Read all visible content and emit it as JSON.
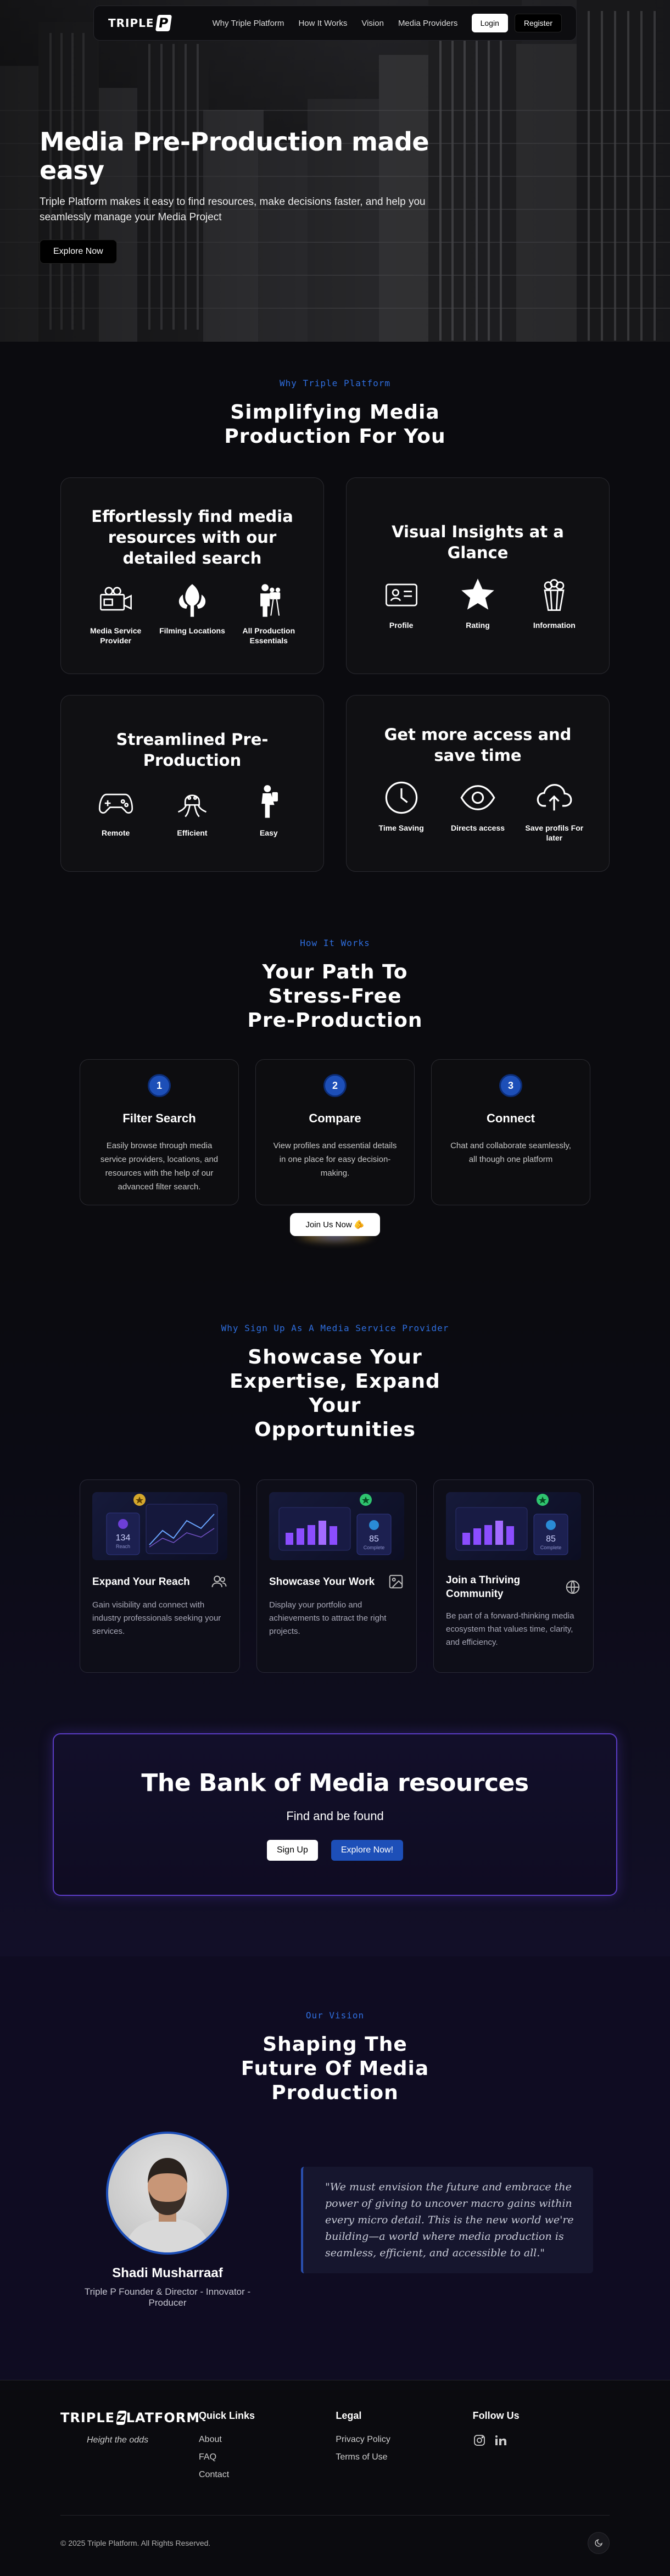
{
  "nav": {
    "logo": "TRIPLE",
    "logo_mark": "P",
    "links": [
      "Why Triple Platform",
      "How It Works",
      "Vision",
      "Media Providers"
    ],
    "login": "Login",
    "register": "Register"
  },
  "hero": {
    "title": "Media Pre-Production made easy",
    "subtitle": "Triple Platform makes it easy to find resources, make decisions faster, and help you seamlessly manage your Media Project",
    "cta": "Explore Now"
  },
  "why": {
    "eyebrow": "Why Triple Platform",
    "title": "Simplifying Media Production For You",
    "cards": [
      {
        "title": "Effortlessly find media resources with our detailed search",
        "items": [
          {
            "icon": "camera-icon",
            "label": "Media Service Provider"
          },
          {
            "icon": "tree-icon",
            "label": "Filming Locations"
          },
          {
            "icon": "crew-icon",
            "label": "All Production Essentials"
          }
        ]
      },
      {
        "title": "Visual Insights at a Glance",
        "items": [
          {
            "icon": "profile-card-icon",
            "label": "Profile"
          },
          {
            "icon": "star-icon",
            "label": "Rating"
          },
          {
            "icon": "popcorn-icon",
            "label": "Information"
          }
        ]
      },
      {
        "title": "Streamlined Pre-Production",
        "items": [
          {
            "icon": "gamepad-icon",
            "label": "Remote"
          },
          {
            "icon": "octopus-icon",
            "label": "Efficient"
          },
          {
            "icon": "sitting-person-icon",
            "label": "Easy"
          }
        ]
      },
      {
        "title": "Get more access and save time",
        "items": [
          {
            "icon": "clock-icon",
            "label": "Time Saving"
          },
          {
            "icon": "eye-icon",
            "label": "Directs access"
          },
          {
            "icon": "cloud-upload-icon",
            "label": "Save profils For later"
          }
        ]
      }
    ]
  },
  "how": {
    "eyebrow": "How It Works",
    "title": "Your Path To Stress-Free Pre-Production",
    "steps": [
      {
        "num": "1",
        "title": "Filter Search",
        "desc": "Easily browse through media service providers, locations, and resources with the help of our advanced filter search."
      },
      {
        "num": "2",
        "title": "Compare",
        "desc": "View profiles and essential details in one place for easy decision-making."
      },
      {
        "num": "3",
        "title": "Connect",
        "desc": "Chat and collaborate seamlessly, all though one platform"
      }
    ],
    "join": "Join Us Now 🫵"
  },
  "showcase": {
    "eyebrow": "Why Sign Up As A Media Service Provider",
    "title": "Showcase Your Expertise, Expand Your Opportunities",
    "cards": [
      {
        "title": "Expand Your Reach",
        "desc": "Gain visibility and connect with industry professionals seeking your services.",
        "stat": "134",
        "stat_label": "Reach"
      },
      {
        "title": "Showcase Your Work",
        "desc": "Display your portfolio and achievements to attract the right projects.",
        "stat": "85",
        "stat_label": "Complete"
      },
      {
        "title": "Join a Thriving Community",
        "desc": "Be part of a forward-thinking media ecosystem that values time, clarity, and efficiency.",
        "stat": "85",
        "stat_label": "Complete"
      }
    ]
  },
  "bank": {
    "title": "The Bank of Media resources",
    "tagline": "Find and be found",
    "signup": "Sign Up",
    "explore": "Explore Now!"
  },
  "vision": {
    "eyebrow": "Our Vision",
    "title": "Shaping The Future Of Media Production",
    "name": "Shadi Musharraaf",
    "role": "Triple P Founder & Director - Innovator - Producer",
    "quote": "\"We must envision the future and embrace the power of giving to uncover macro gains within every micro detail. This is the new world we're building—a world where media production is seamless, efficient, and accessible to all.\""
  },
  "footer": {
    "logo": "TRIPLE",
    "logo_tail": "LATFORM",
    "motto": "Height the odds",
    "quick_title": "Quick Links",
    "quick": [
      "About",
      "FAQ",
      "Contact"
    ],
    "legal_title": "Legal",
    "legal": [
      "Privacy Policy",
      "Terms of Use"
    ],
    "follow_title": "Follow Us",
    "copyright": "© 2025 Triple Platform. All Rights Reserved."
  },
  "colors": {
    "accent": "#1d4fb8",
    "eyebrow": "#2f6fe0",
    "bank_border": "#5a3cc4",
    "background": "#0b0b0f"
  }
}
